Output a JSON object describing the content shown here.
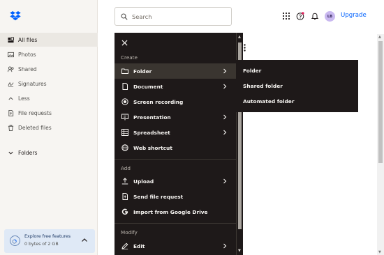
{
  "sidebar": {
    "items": [
      {
        "label": "All files",
        "icon": "folders-icon",
        "active": true
      },
      {
        "label": "Photos",
        "icon": "photo-icon",
        "active": false
      },
      {
        "label": "Shared",
        "icon": "share-icon",
        "active": false
      },
      {
        "label": "Signatures",
        "icon": "signature-icon",
        "active": false
      },
      {
        "label": "Less",
        "icon": "chevron-up-icon",
        "active": false
      },
      {
        "label": "File requests",
        "icon": "file-request-icon",
        "active": false
      },
      {
        "label": "Deleted files",
        "icon": "trash-icon",
        "active": false
      }
    ],
    "folders_label": "Folders",
    "promo": {
      "title": "Explore free features",
      "subtitle": "0 bytes of 2 GB"
    }
  },
  "header": {
    "search_placeholder": "Search",
    "avatar_initials": "LB",
    "upgrade_label": "Upgrade"
  },
  "create_menu": {
    "sections": {
      "create": "Create",
      "add": "Add",
      "modify": "Modify"
    },
    "create_items": [
      {
        "label": "Folder",
        "icon": "folder-icon",
        "has_submenu": true,
        "highlighted": true
      },
      {
        "label": "Document",
        "icon": "document-icon",
        "has_submenu": true
      },
      {
        "label": "Screen recording",
        "icon": "record-icon",
        "has_submenu": false
      },
      {
        "label": "Presentation",
        "icon": "presentation-icon",
        "has_submenu": true
      },
      {
        "label": "Spreadsheet",
        "icon": "spreadsheet-icon",
        "has_submenu": true
      },
      {
        "label": "Web shortcut",
        "icon": "globe-icon",
        "has_submenu": false
      }
    ],
    "add_items": [
      {
        "label": "Upload",
        "icon": "upload-icon",
        "has_submenu": true
      },
      {
        "label": "Send file request",
        "icon": "file-request-icon",
        "has_submenu": false
      },
      {
        "label": "Import from Google Drive",
        "icon": "google-icon",
        "has_submenu": false
      }
    ],
    "modify_items": [
      {
        "label": "Edit",
        "icon": "edit-icon",
        "has_submenu": true
      }
    ]
  },
  "folder_submenu": {
    "items": [
      "Folder",
      "Shared folder",
      "Automated folder"
    ]
  },
  "colors": {
    "accent": "#0061fe",
    "menu_bg": "#1e1919",
    "sidebar_bg": "#f7f5f2"
  }
}
